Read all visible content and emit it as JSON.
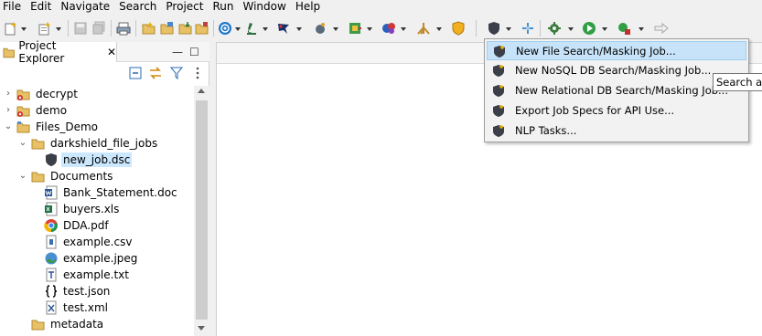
{
  "menubar": {
    "items": [
      "File",
      "Edit",
      "Navigate",
      "Search",
      "Project",
      "Run",
      "Window",
      "Help"
    ]
  },
  "explorer": {
    "tab_title": "Project Explorer",
    "close_glyph": "✕",
    "minimize_glyph": "—",
    "maximize_glyph": "☐",
    "tree": [
      {
        "label": "decrypt",
        "depth": 0,
        "expanded": false,
        "icon": "project-error-icon"
      },
      {
        "label": "demo",
        "depth": 0,
        "expanded": false,
        "icon": "project-error-icon"
      },
      {
        "label": "Files_Demo",
        "depth": 0,
        "expanded": true,
        "icon": "project-icon"
      },
      {
        "label": "darkshield_file_jobs",
        "depth": 1,
        "expanded": true,
        "icon": "folder-icon"
      },
      {
        "label": "new_job.dsc",
        "depth": 2,
        "selected": true,
        "icon": "shield-file-icon"
      },
      {
        "label": "Documents",
        "depth": 1,
        "expanded": true,
        "icon": "folder-icon"
      },
      {
        "label": "Bank_Statement.doc",
        "depth": 2,
        "icon": "word-doc-icon"
      },
      {
        "label": "buyers.xls",
        "depth": 2,
        "icon": "excel-icon"
      },
      {
        "label": "DDA.pdf",
        "depth": 2,
        "icon": "pdf-chrome-icon"
      },
      {
        "label": "example.csv",
        "depth": 2,
        "icon": "csv-file-icon"
      },
      {
        "label": "example.jpeg",
        "depth": 2,
        "icon": "image-file-icon"
      },
      {
        "label": "example.txt",
        "depth": 2,
        "icon": "text-file-icon"
      },
      {
        "label": "test.json",
        "depth": 2,
        "icon": "json-braces-icon"
      },
      {
        "label": "test.xml",
        "depth": 2,
        "icon": "xml-file-icon"
      },
      {
        "label": "metadata",
        "depth": 1,
        "expanded": false,
        "icon": "folder-icon"
      }
    ]
  },
  "dropdown": {
    "items": [
      {
        "label": "New File Search/Masking Job...",
        "hover": true
      },
      {
        "label": "New NoSQL DB Search/Masking Job..."
      },
      {
        "label": "New Relational DB Search/Masking Job..."
      },
      {
        "label": "Export Job Specs for API Use..."
      },
      {
        "label": "NLP Tasks..."
      }
    ]
  },
  "tooltip": {
    "text": "Search and"
  },
  "colors": {
    "selection": "#cce8ff",
    "menu_hover": "#c6e3f9",
    "folder": "#e8c166",
    "shield": "#3a3f4a"
  }
}
